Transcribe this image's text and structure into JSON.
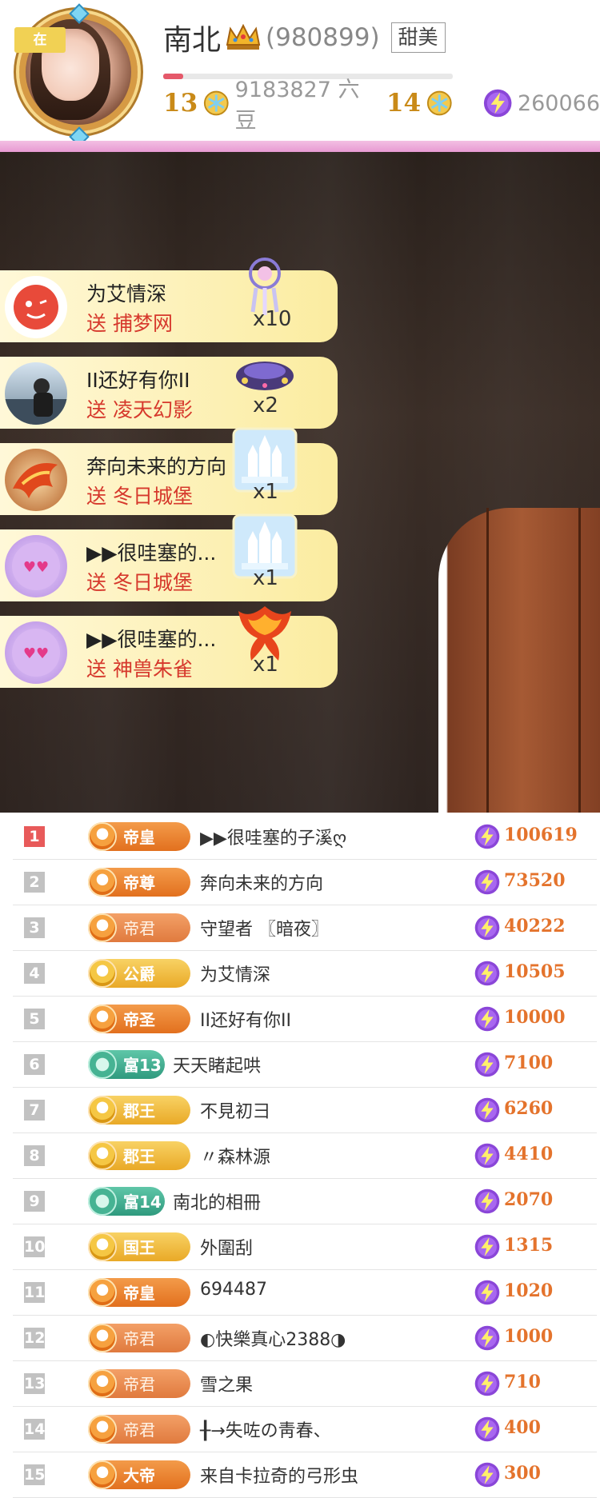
{
  "header": {
    "live_badge": "在",
    "anchor_name": "南北",
    "anchor_id": "(980899)",
    "tag": "甜美",
    "level_left": "13",
    "beans": "9183827 六豆",
    "level_right": "14",
    "energy": "260066",
    "level_progress": 0.07,
    "accent": "#e79ad2"
  },
  "gifts": [
    {
      "user": "为艾情深",
      "send": "送 捕梦网",
      "count": "x10",
      "avatar_color": "#e84a3a",
      "gift_icon": "dreamcatcher-icon"
    },
    {
      "user": "II还好有你II",
      "send": "送 凌天幻影",
      "count": "x2",
      "avatar_color": "#5a6a80",
      "gift_icon": "phantom-car-icon"
    },
    {
      "user": "奔向未来的方向",
      "send": "送 冬日城堡",
      "count": "x1",
      "avatar_color": "#b5622a",
      "gift_icon": "winter-castle-icon"
    },
    {
      "user": "▶▶很哇塞的...",
      "send": "送 冬日城堡",
      "count": "x1",
      "avatar_color": "#c79ce6",
      "gift_icon": "winter-castle-icon"
    },
    {
      "user": "▶▶很哇塞的...",
      "send": "送 神兽朱雀",
      "count": "x1",
      "avatar_color": "#c79ce6",
      "gift_icon": "phoenix-icon"
    }
  ],
  "ranking": [
    {
      "rank": "1",
      "title": "帝皇",
      "name": "▶▶很哇塞的子溪ღ",
      "score": "100619",
      "style": "orange"
    },
    {
      "rank": "2",
      "title": "帝尊",
      "name": "奔向未来的方向",
      "score": "73520",
      "style": "orange"
    },
    {
      "rank": "3",
      "title": "帝君",
      "name": "守望者 〖暗夜〗",
      "score": "40222",
      "style": "muted"
    },
    {
      "rank": "4",
      "title": "公爵",
      "name": "为艾情深",
      "score": "10505",
      "style": "gold"
    },
    {
      "rank": "5",
      "title": "帝圣",
      "name": "II还好有你II",
      "score": "10000",
      "style": "orange"
    },
    {
      "rank": "6",
      "title": "富13",
      "name": "天天睹起哄",
      "score": "7100",
      "style": "teal"
    },
    {
      "rank": "7",
      "title": "郡王",
      "name": "不見初彐",
      "score": "6260",
      "style": "gold"
    },
    {
      "rank": "8",
      "title": "郡王",
      "name": "〃森林源",
      "score": "4410",
      "style": "gold"
    },
    {
      "rank": "9",
      "title": "富14",
      "name": "南北的相冊",
      "score": "2070",
      "style": "teal"
    },
    {
      "rank": "10",
      "title": "国王",
      "name": "外圍刮",
      "score": "1315",
      "style": "gold"
    },
    {
      "rank": "11",
      "title": "帝皇",
      "name": "694487",
      "score": "1020",
      "style": "orange"
    },
    {
      "rank": "12",
      "title": "帝君",
      "name": "◐快樂真心2388◑",
      "score": "1000",
      "style": "muted"
    },
    {
      "rank": "13",
      "title": "帝君",
      "name": "雪之果",
      "score": "710",
      "style": "muted"
    },
    {
      "rank": "14",
      "title": "帝君",
      "name": "╂→失咗の靑春、",
      "score": "400",
      "style": "muted"
    },
    {
      "rank": "15",
      "title": "大帝",
      "name": "来自卡拉奇的弓形虫",
      "score": "300",
      "style": "orange"
    }
  ]
}
